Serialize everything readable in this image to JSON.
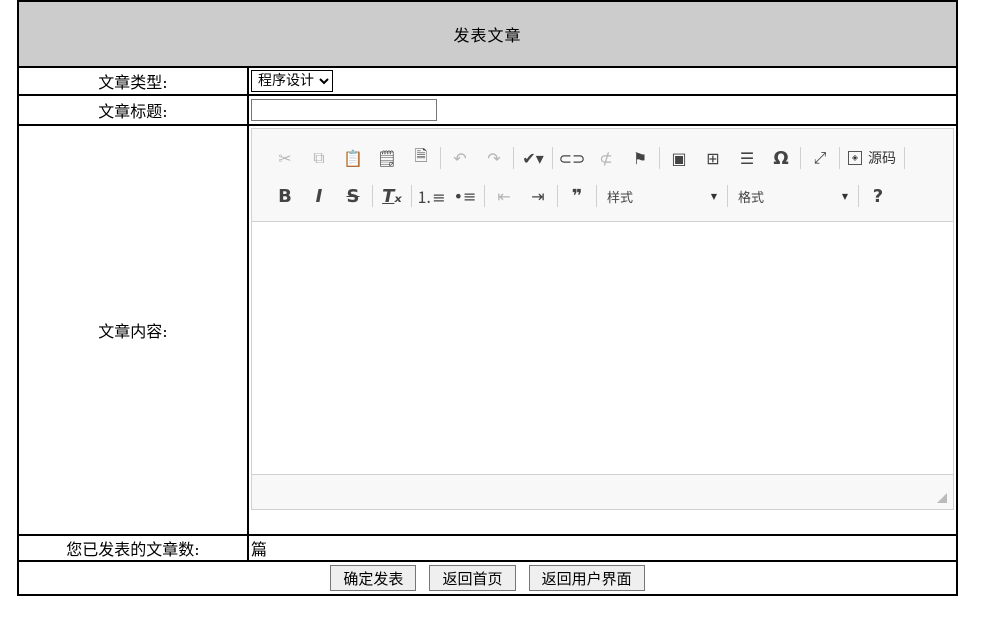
{
  "page_title": "发表文章",
  "form": {
    "type_label": "文章类型:",
    "type_selected": "程序设计",
    "title_label": "文章标题:",
    "title_value": "",
    "content_label": "文章内容:",
    "count_label": "您已发表的文章数:",
    "count_unit": "篇"
  },
  "editor": {
    "source_label": "源码",
    "style_combo": "样式",
    "format_combo": "格式",
    "help_label": "?"
  },
  "buttons": {
    "submit": "确定发表",
    "home": "返回首页",
    "user": "返回用户界面"
  }
}
